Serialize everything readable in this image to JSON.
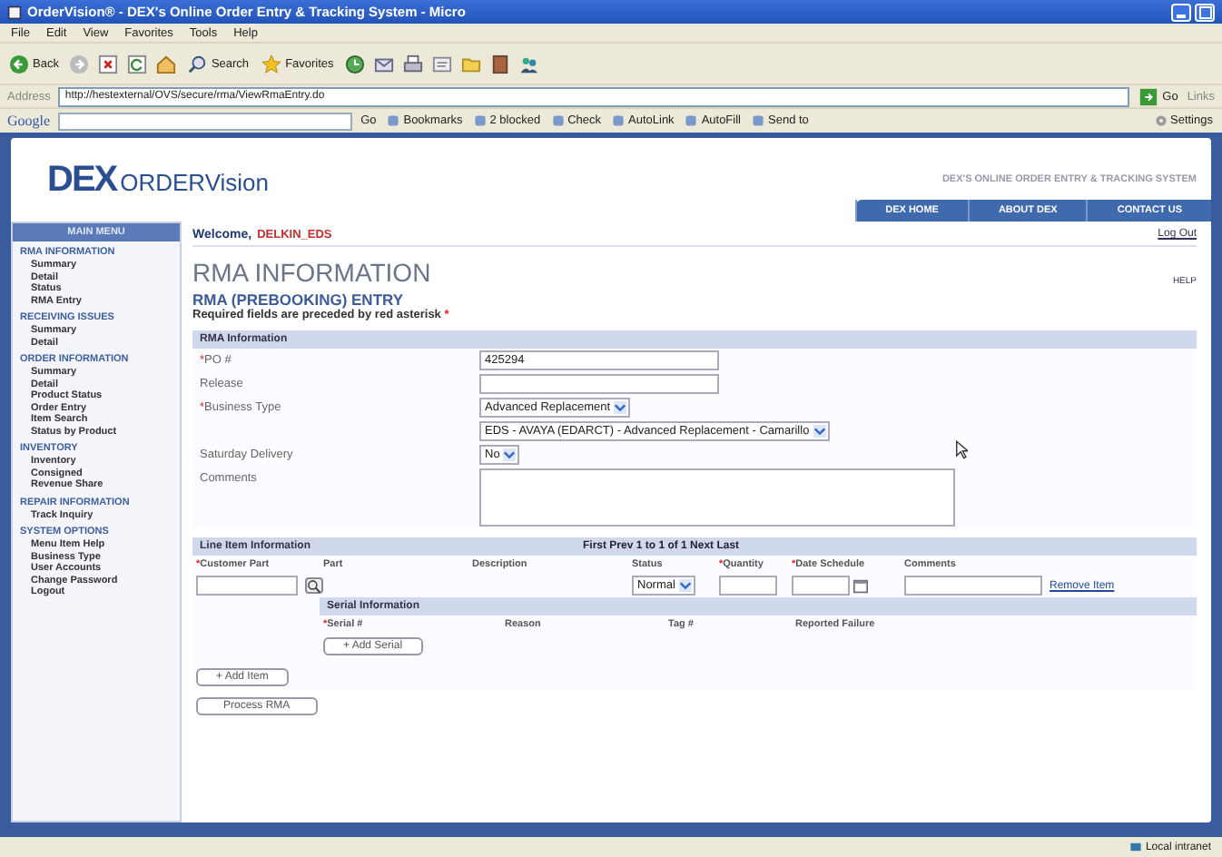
{
  "window": {
    "title": "OrderVision® - DEX's Online Order Entry & Tracking System - Micro"
  },
  "menu": [
    "File",
    "Edit",
    "View",
    "Favorites",
    "Tools",
    "Help"
  ],
  "toolbar": {
    "back": "Back",
    "search": "Search",
    "favorites": "Favorites"
  },
  "address": {
    "label": "Address",
    "url": "http://hestexternal/OVS/secure/rma/ViewRmaEntry.do",
    "go": "Go",
    "links": "Links"
  },
  "google_bar": {
    "logo": "Google",
    "go": "Go",
    "items": [
      "Bookmarks",
      "2 blocked",
      "Check",
      "AutoLink",
      "AutoFill",
      "Send to"
    ],
    "settings": "Settings"
  },
  "header": {
    "logo_mark": "DEX",
    "logo_text": "ORDERVision",
    "tagline": "DEX'S ONLINE ORDER ENTRY & TRACKING SYSTEM",
    "nav": [
      {
        "label": "DEX HOME",
        "selected": false
      },
      {
        "label": "ABOUT DEX",
        "selected": false
      },
      {
        "label": "CONTACT US",
        "selected": false
      }
    ]
  },
  "sidebar": {
    "title": "MAIN MENU",
    "sections": [
      {
        "heading": "RMA INFORMATION",
        "items": [
          "Summary",
          "Detail",
          "Status",
          "RMA Entry"
        ]
      },
      {
        "heading": "RECEIVING ISSUES",
        "items": [
          "Summary",
          "Detail"
        ]
      },
      {
        "heading": "ORDER INFORMATION",
        "items": [
          "Summary",
          "Detail",
          "Product Status",
          "Order Entry",
          "Item Search",
          "Status by Product"
        ]
      },
      {
        "heading": "INVENTORY",
        "items": [
          "Inventory",
          "Consigned",
          "Revenue Share"
        ]
      },
      {
        "heading": "REPAIR INFORMATION",
        "items": [
          "Track Inquiry"
        ]
      },
      {
        "heading": "SYSTEM OPTIONS",
        "items": [
          "Menu Item Help",
          "Business Type",
          "User Accounts",
          "Change Password",
          "Logout"
        ]
      }
    ]
  },
  "welcome": {
    "label": "Welcome,",
    "user": "DELKIN_EDS",
    "logout": "Log Out",
    "help": "HELP"
  },
  "page_title": "RMA INFORMATION",
  "subtitle": "RMA (PREBOOKING) ENTRY",
  "note": {
    "text": "Required fields are preceded by red asterisk",
    "mark": "*"
  },
  "rma_section": {
    "title": "RMA Information",
    "rows": [
      {
        "mark": "*",
        "label": "PO #",
        "controls": [
          {
            "kind": "text",
            "value": "425294"
          }
        ]
      },
      {
        "label": "Release",
        "controls": [
          {
            "kind": "text"
          }
        ]
      },
      {
        "mark": "*",
        "label": "Business Type",
        "controls": [
          {
            "kind": "select",
            "value": "Advanced Replacement"
          },
          {
            "kind": "select",
            "value": "EDS - AVAYA (EDARCT) - Advanced Replacement - Camarillo"
          }
        ]
      },
      {
        "label": "Saturday Delivery",
        "controls": [
          {
            "kind": "select",
            "value": "No"
          }
        ]
      },
      {
        "label": "Comments",
        "controls": [
          {
            "kind": "textarea"
          }
        ]
      }
    ]
  },
  "line_items": {
    "title": "Line Item Information",
    "pager": "First Prev 1 to 1 of 1 Next Last",
    "columns": [
      {
        "mark": "*",
        "label": "Customer Part"
      },
      {
        "label": "Part"
      },
      {
        "label": "Description"
      },
      {
        "label": "Status"
      },
      {
        "mark": "*",
        "label": "Quantity"
      },
      {
        "mark": "*",
        "label": "Date Schedule"
      },
      {
        "label": "Comments"
      }
    ],
    "row": {
      "status": "Normal",
      "remove": "Remove Item"
    },
    "serial": {
      "title": "Serial Information",
      "columns": [
        {
          "mark": "*",
          "label": "Serial #"
        },
        {
          "label": "Reason"
        },
        {
          "label": "Tag #"
        },
        {
          "label": "Reported Failure"
        }
      ],
      "add": "+ Add Serial"
    },
    "add_item": "+ Add Item",
    "process": "Process RMA"
  },
  "status_bar": {
    "zone": "Local intranet"
  }
}
